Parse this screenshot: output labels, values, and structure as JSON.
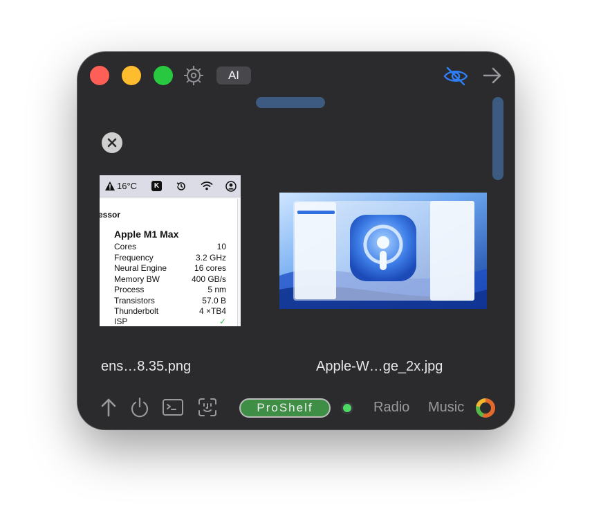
{
  "titlebar": {
    "ai_label": "AI",
    "icons": [
      "gear-icon",
      "eye-slash-icon",
      "arrow-right-icon"
    ]
  },
  "shelf": {
    "items": [
      {
        "filename": "ens…8.35.png",
        "preview": {
          "menubar": {
            "weather": "16°C",
            "k_badge": "K"
          },
          "heading": "essor",
          "title": "Apple M1 Max",
          "rows": [
            {
              "key": "Cores",
              "value": "10"
            },
            {
              "key": "Frequency",
              "value": "3.2  GHz"
            },
            {
              "key": "Neural Engine",
              "value": "16  cores"
            },
            {
              "key": "Memory BW",
              "value": "400  GB/s"
            },
            {
              "key": "Process",
              "value": "5  nm"
            },
            {
              "key": "Transistors",
              "value": "57.0  B"
            },
            {
              "key": "Thunderbolt",
              "value": "4  ×TB4"
            },
            {
              "key": "ISP",
              "value": "✓"
            }
          ]
        }
      },
      {
        "filename": "Apple-W…ge_2x.jpg"
      }
    ]
  },
  "bottombar": {
    "proshelf_label": "ProShelf",
    "radio_label": "Radio",
    "music_label": "Music",
    "icons": [
      "upload-arrow-icon",
      "power-icon",
      "terminal-icon",
      "face-id-icon"
    ]
  },
  "colors": {
    "window_bg": "#2b2b2e",
    "accent_blue": "#3d5a80",
    "eye_blue": "#2f7ff7",
    "proshelf_green": "#3e8e46",
    "status_green": "#4cd964"
  }
}
